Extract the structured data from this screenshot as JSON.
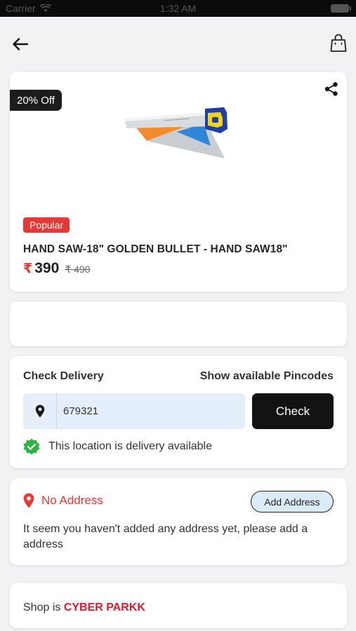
{
  "status_bar": {
    "carrier": "Carrier",
    "time": "1:32 AM"
  },
  "header": {
    "back_icon": "arrow-left-icon",
    "bag_icon": "shopping-bag-icon"
  },
  "product": {
    "discount_badge": "20% Off",
    "share_icon": "share-icon",
    "badge": "Popular",
    "title": "HAND SAW-18\" GOLDEN BULLET - HAND SAW18\"",
    "currency": "₹",
    "price": "390",
    "old_price": "₹ 490"
  },
  "delivery": {
    "heading": "Check Delivery",
    "pincodes_link": "Show available Pincodes",
    "pincode_value": "679321",
    "check_label": "Check",
    "availability_text": "This location is delivery available"
  },
  "address": {
    "status": "No Address",
    "add_button": "Add Address",
    "message": "It seem you haven't added any address yet, please add a address"
  },
  "shop": {
    "prefix": "Shop is ",
    "name": "CYBER PARKK"
  },
  "colors": {
    "accent_red": "#e53935",
    "verified_green": "#2fb344",
    "button_dark": "#131313",
    "input_bg": "#e4effb"
  }
}
